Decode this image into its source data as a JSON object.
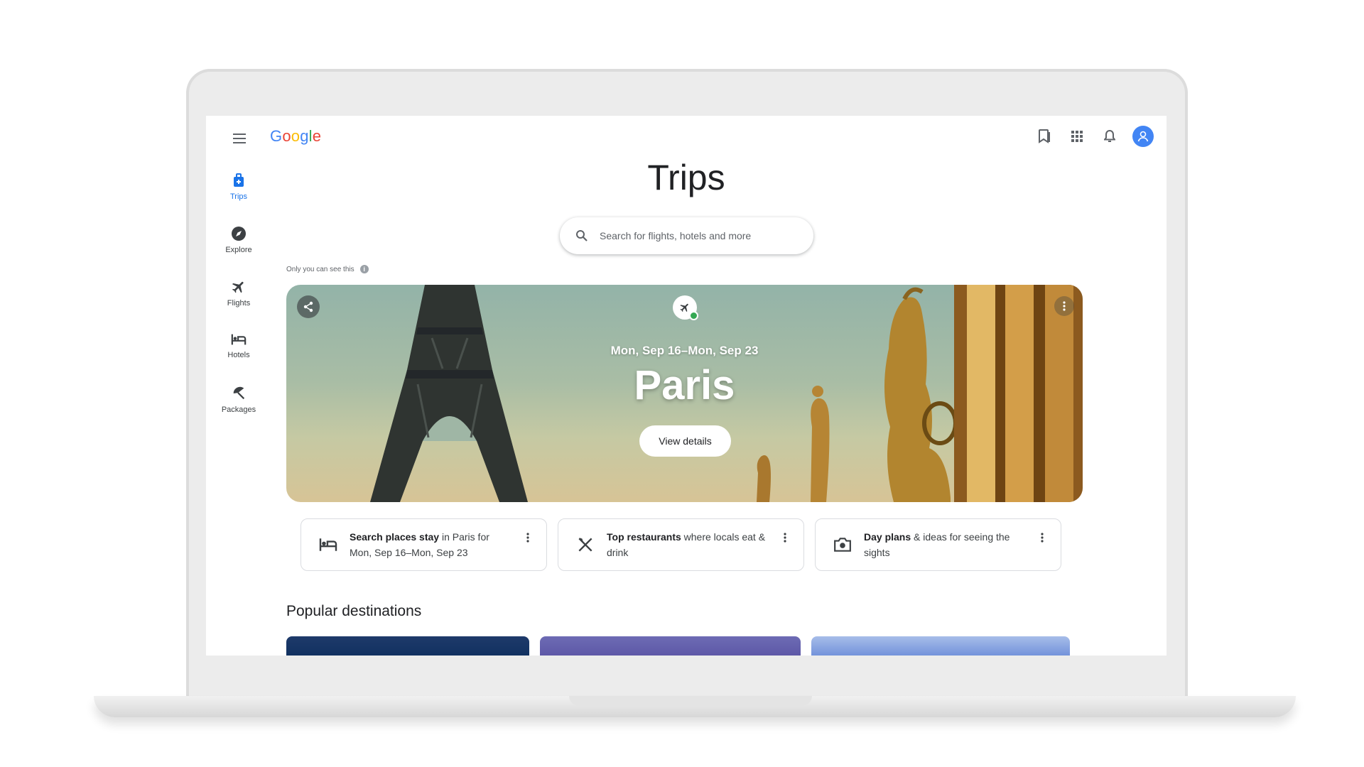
{
  "app": {
    "logo": {
      "letters": [
        {
          "ch": "G",
          "color": "#4285f4"
        },
        {
          "ch": "o",
          "color": "#ea4335"
        },
        {
          "ch": "o",
          "color": "#fbbc05"
        },
        {
          "ch": "g",
          "color": "#4285f4"
        },
        {
          "ch": "l",
          "color": "#34a853"
        },
        {
          "ch": "e",
          "color": "#ea4335"
        }
      ]
    },
    "accent_color": "#1a73e8"
  },
  "header": {
    "icons": [
      "saved-bookmark-icon",
      "apps-grid-icon",
      "notifications-bell-icon",
      "account-avatar-icon"
    ]
  },
  "nav": {
    "items": [
      {
        "label": "Trips",
        "icon": "trips-suitcase-icon",
        "active": true
      },
      {
        "label": "Explore",
        "icon": "explore-compass-icon",
        "active": false
      },
      {
        "label": "Flights",
        "icon": "flight-plane-icon",
        "active": false
      },
      {
        "label": "Hotels",
        "icon": "hotel-bed-icon",
        "active": false
      },
      {
        "label": "Packages",
        "icon": "packages-beach-umbrella-icon",
        "active": false
      }
    ]
  },
  "main": {
    "title": "Trips",
    "search": {
      "placeholder": "Search for flights, hotels and more",
      "value": ""
    },
    "privacy_note": "Only you can see this",
    "trip": {
      "dates": "Mon, Sep 16–Mon, Sep 23",
      "city": "Paris",
      "view_button": "View details"
    },
    "cards": [
      {
        "icon": "hotel-bed-icon",
        "bold": "Search places stay",
        "rest": " in Paris for Mon, Sep 16–Mon, Sep 23"
      },
      {
        "icon": "restaurant-utensils-icon",
        "bold": "Top restaurants",
        "rest": " where locals eat & drink"
      },
      {
        "icon": "camera-icon",
        "bold": "Day plans",
        "rest": " & ideas for seeing the sights"
      }
    ],
    "popular_title": "Popular destinations"
  }
}
